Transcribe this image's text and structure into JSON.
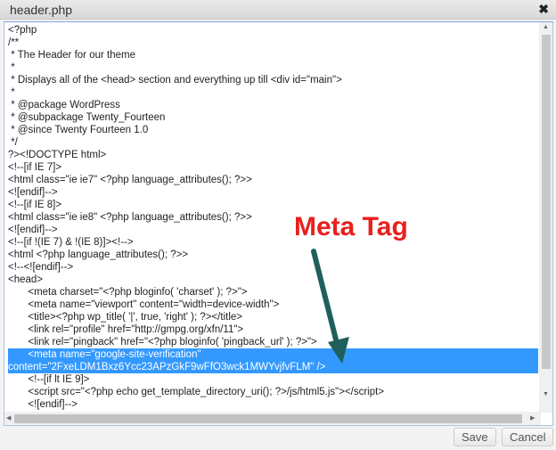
{
  "window": {
    "title": "header.php",
    "close_icon": "close-icon"
  },
  "code_lines": [
    "<?php",
    "/**",
    " * The Header for our theme",
    " *",
    " * Displays all of the <head> section and everything up till <div id=\"main\">",
    " *",
    " * @package WordPress",
    " * @subpackage Twenty_Fourteen",
    " * @since Twenty Fourteen 1.0",
    " */",
    "?><!DOCTYPE html>",
    "<!--[if IE 7]>",
    "<html class=\"ie ie7\" <?php language_attributes(); ?>>",
    "<![endif]-->",
    "<!--[if IE 8]>",
    "<html class=\"ie ie8\" <?php language_attributes(); ?>>",
    "<![endif]-->",
    "<!--[if !(IE 7) & !(IE 8)]><!-->",
    "<html <?php language_attributes(); ?>>",
    "<!--<![endif]-->",
    "<head>",
    "       <meta charset=\"<?php bloginfo( 'charset' ); ?>\">",
    "       <meta name=\"viewport\" content=\"width=device-width\">",
    "       <title><?php wp_title( '|', true, 'right' ); ?></title>",
    "       <link rel=\"profile\" href=\"http://gmpg.org/xfn/11\">",
    "       <link rel=\"pingback\" href=\"<?php bloginfo( 'pingback_url' ); ?>\">",
    "       <meta name=\"google-site-verification\"",
    "content=\"2FxeLDM1Bxz6Ycc23APzGkF9wFfO3wck1MWYvjfvFLM\" />",
    "       <!--[if lt IE 9]>",
    "       <script src=\"<?php echo get_template_directory_uri(); ?>/js/html5.js\"></script>",
    "       <![endif]-->"
  ],
  "selected_lines": [
    26,
    27
  ],
  "annotation": {
    "label": "Meta Tag",
    "color": "#e8201c",
    "arrow_color": "#1f5f5c"
  },
  "footer": {
    "save_label": "Save",
    "cancel_label": "Cancel"
  }
}
